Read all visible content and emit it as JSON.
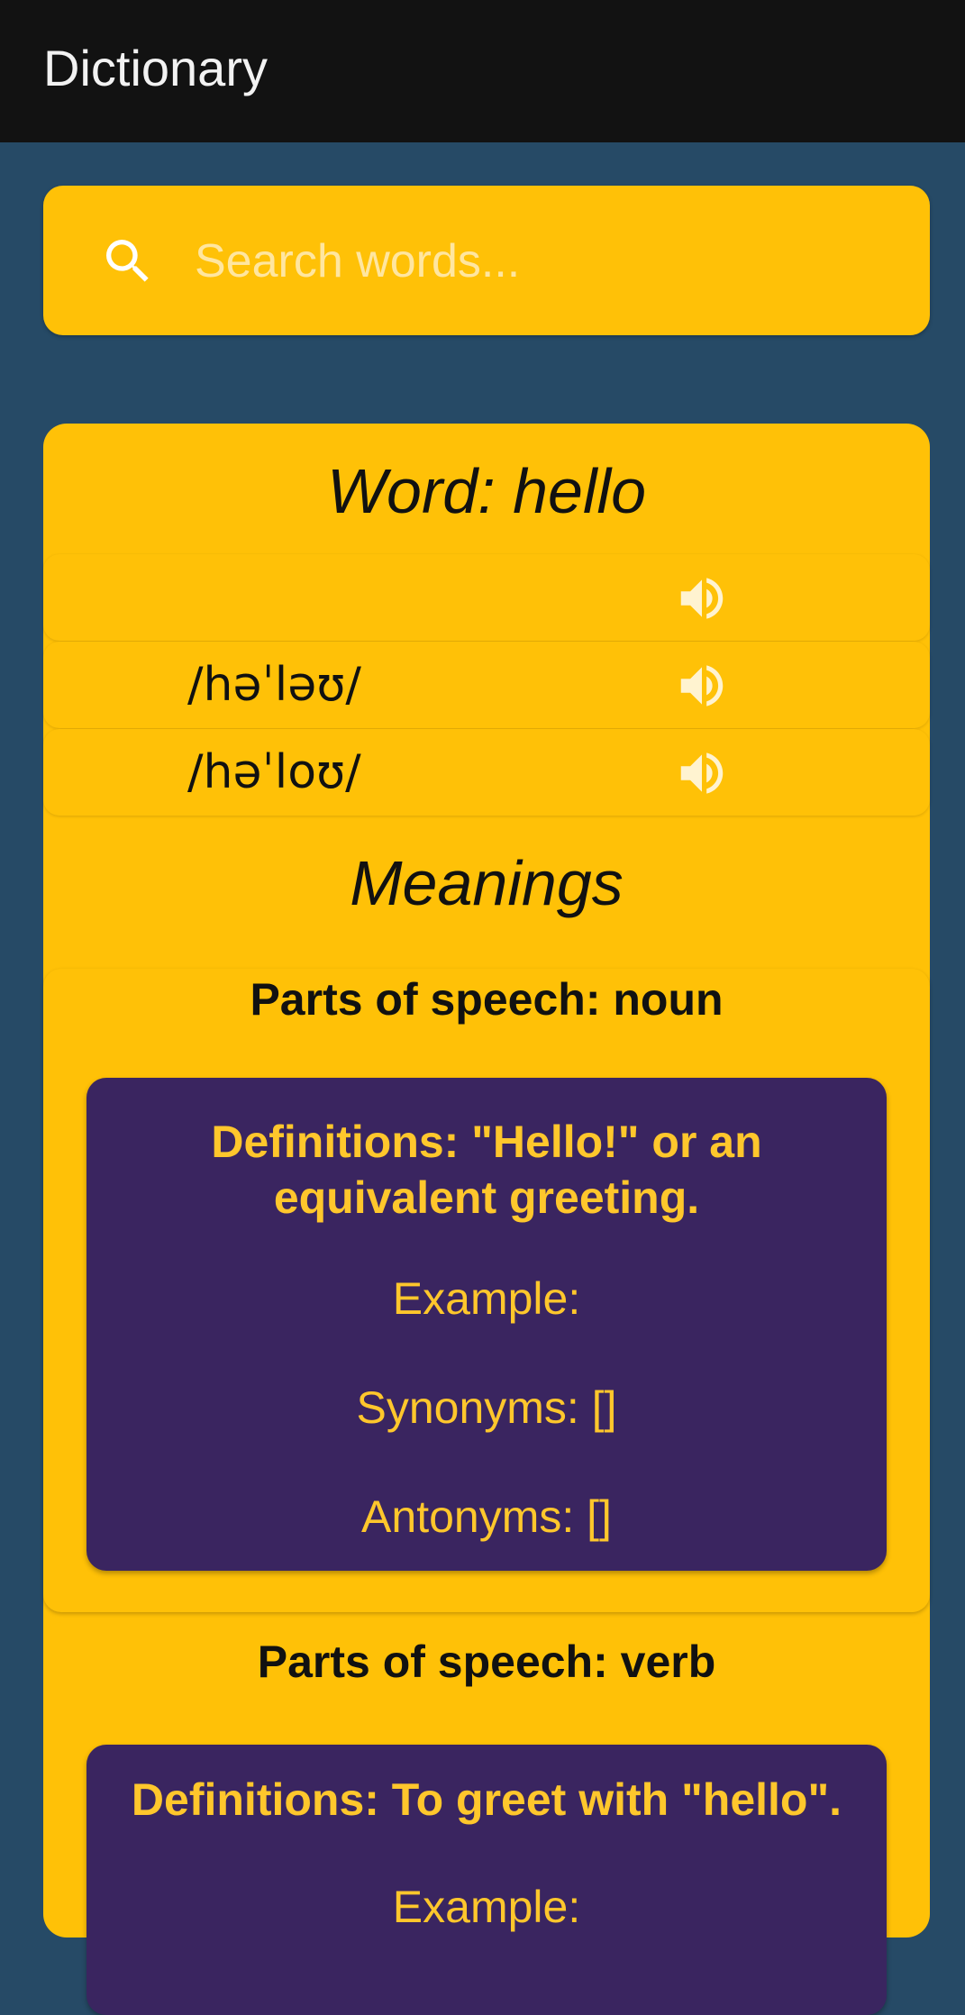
{
  "app": {
    "title": "Dictionary"
  },
  "search": {
    "placeholder": "Search words...",
    "value": ""
  },
  "word": {
    "title": "Word: hello"
  },
  "phonetics": [
    {
      "text": "",
      "audio_icon": "speaker-icon"
    },
    {
      "text": "/həˈləʊ/",
      "audio_icon": "speaker-icon"
    },
    {
      "text": "/həˈloʊ/",
      "audio_icon": "speaker-icon"
    }
  ],
  "meanings": {
    "title": "Meanings",
    "items": [
      {
        "pos": "Parts of speech: noun",
        "definition": "Definitions: \"Hello!\" or an equivalent greeting.",
        "example": "Example:",
        "synonyms": "Synonyms: []",
        "antonyms": "Antonyms: []"
      },
      {
        "pos": "Parts of speech: verb",
        "definition": "Definitions: To greet with \"hello\".",
        "example": "Example:"
      }
    ]
  },
  "colors": {
    "background": "#264a66",
    "appbar": "#121212",
    "accent": "#ffc107",
    "definition_card": "#3a2560",
    "definition_text": "#ffc72c"
  }
}
